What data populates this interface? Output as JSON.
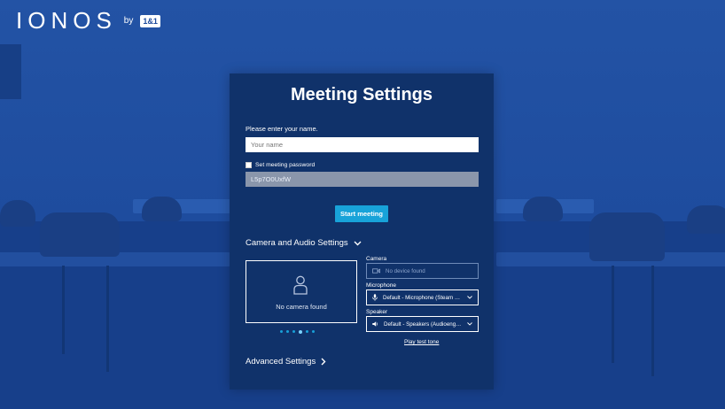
{
  "logo": {
    "brand": "IONOS",
    "by": "by",
    "badge": "1&1"
  },
  "dialog": {
    "title": "Meeting Settings",
    "name_prompt": "Please enter your name.",
    "name_placeholder": "Your name",
    "password_checkbox_label": "Set meeting password",
    "password_value": "L5p7O0UxfW",
    "start_button": "Start meeting",
    "camera_audio_section": "Camera and Audio Settings",
    "camera_preview_text": "No camera found",
    "camera_label": "Camera",
    "camera_value": "No device found",
    "microphone_label": "Microphone",
    "microphone_value": "Default - Microphone (Steam S…",
    "speaker_label": "Speaker",
    "speaker_value": "Default - Speakers (Audioengin…",
    "test_tone_link": "Play test tone",
    "advanced_section": "Advanced Settings"
  },
  "colors": {
    "card_bg": "#10326a",
    "accent": "#18a3d9",
    "background": "#1d4a9c"
  },
  "icons": [
    "person-icon",
    "video-icon",
    "microphone-icon",
    "speaker-icon",
    "chevron-down-icon",
    "chevron-right-icon"
  ]
}
